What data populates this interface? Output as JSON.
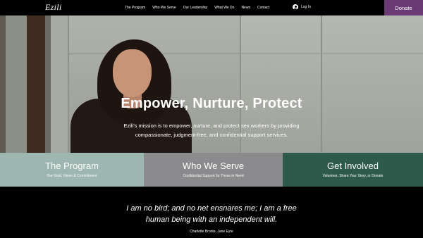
{
  "header": {
    "logo": "Ezili",
    "nav": [
      "The Program",
      "Who We Serve",
      "Our Leadership",
      "What We Do",
      "News",
      "Contact"
    ],
    "login_label": "Log In",
    "donate_label": "Donate",
    "donate_color": "#6a3a74"
  },
  "hero": {
    "title": "Empower, Nurture, Protect",
    "text": "Ezili's mission is to empower, nurture, and protect sex workers by providing compassionate, judgment-free, and confidential support services."
  },
  "panels": [
    {
      "title": "The Program",
      "subtitle": "Our Goal, Vision & Commitment",
      "color": "#9db6b0"
    },
    {
      "title": "Who We Serve",
      "subtitle": "Confidential Support for Those in Need",
      "color": "#8b8a8c"
    },
    {
      "title": "Get Involved",
      "subtitle": "Volunteer, Share Your Story, or Donate",
      "color": "#2e5a4c"
    }
  ],
  "quote": {
    "line1": "I am no bird; and no net ensnares me; I am a free",
    "line2": "human being with an independent will.",
    "citation": "Charlotte Bronte, Jane Eyre"
  }
}
